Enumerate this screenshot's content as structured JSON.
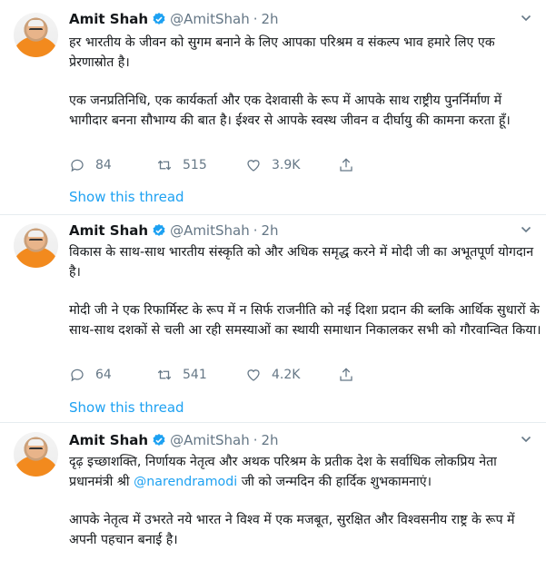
{
  "tweets": [
    {
      "name": "Amit Shah",
      "handle": "@AmitShah",
      "sep": "·",
      "time": "2h",
      "para1": "हर भारतीय के जीवन को सुगम बनाने के लिए  आपका परिश्रम व संकल्प भाव हमारे लिए एक प्रेरणास्रोत है।",
      "para2": "एक जनप्रतिनिधि, एक कार्यकर्ता और एक देशवासी के रूप में आपके साथ राष्ट्रीय पुनर्निर्माण में भागीदार बनना सौभाग्य की बात है। ईश्वर से आपके स्वस्थ जीवन व दीर्घायु की कामना करता हूँ।",
      "replies": "84",
      "retweets": "515",
      "likes": "3.9K",
      "show_thread": "Show this thread"
    },
    {
      "name": "Amit Shah",
      "handle": "@AmitShah",
      "sep": "·",
      "time": "2h",
      "para1": "विकास के साथ-साथ भारतीय संस्कृति को और अधिक समृद्ध करने में मोदी जी का अभूतपूर्ण योगदान है।",
      "para2": "मोदी जी ने एक रिफार्मिस्ट के रूप में न सिर्फ राजनीति को नई दिशा प्रदान की ब्लकि आर्थिक सुधारों के साथ-साथ दशकों से चली आ रही समस्याओं का स्थायी समाधान निकालकर सभी को गौरवान्वित किया।",
      "replies": "64",
      "retweets": "541",
      "likes": "4.2K",
      "show_thread": "Show this thread"
    },
    {
      "name": "Amit Shah",
      "handle": "@AmitShah",
      "sep": "·",
      "time": "2h",
      "para1_pre": "दृढ़ इच्छाशक्ति, निर्णायक नेतृत्व और अथक परिश्रम के प्रतीक देश के सर्वाधिक लोकप्रिय नेता प्रधानमंत्री श्री ",
      "mention": "@narendramodi",
      "para1_post": " जी को जन्मदिन की हार्दिक शुभकामनाएं।",
      "para2": "आपके नेतृत्व में उभरते नये भारत ने विश्व में एक मजबूत, सुरक्षित और विश्वसनीय राष्ट्र के रूप में अपनी पहचान बनाई है।"
    }
  ],
  "colors": {
    "accent": "#1da1f2",
    "muted": "#657786",
    "text": "#14171a",
    "border": "#e6ecf0"
  },
  "icons": [
    "verified-icon",
    "chevron-down-icon",
    "reply-icon",
    "retweet-icon",
    "like-icon",
    "share-icon"
  ]
}
